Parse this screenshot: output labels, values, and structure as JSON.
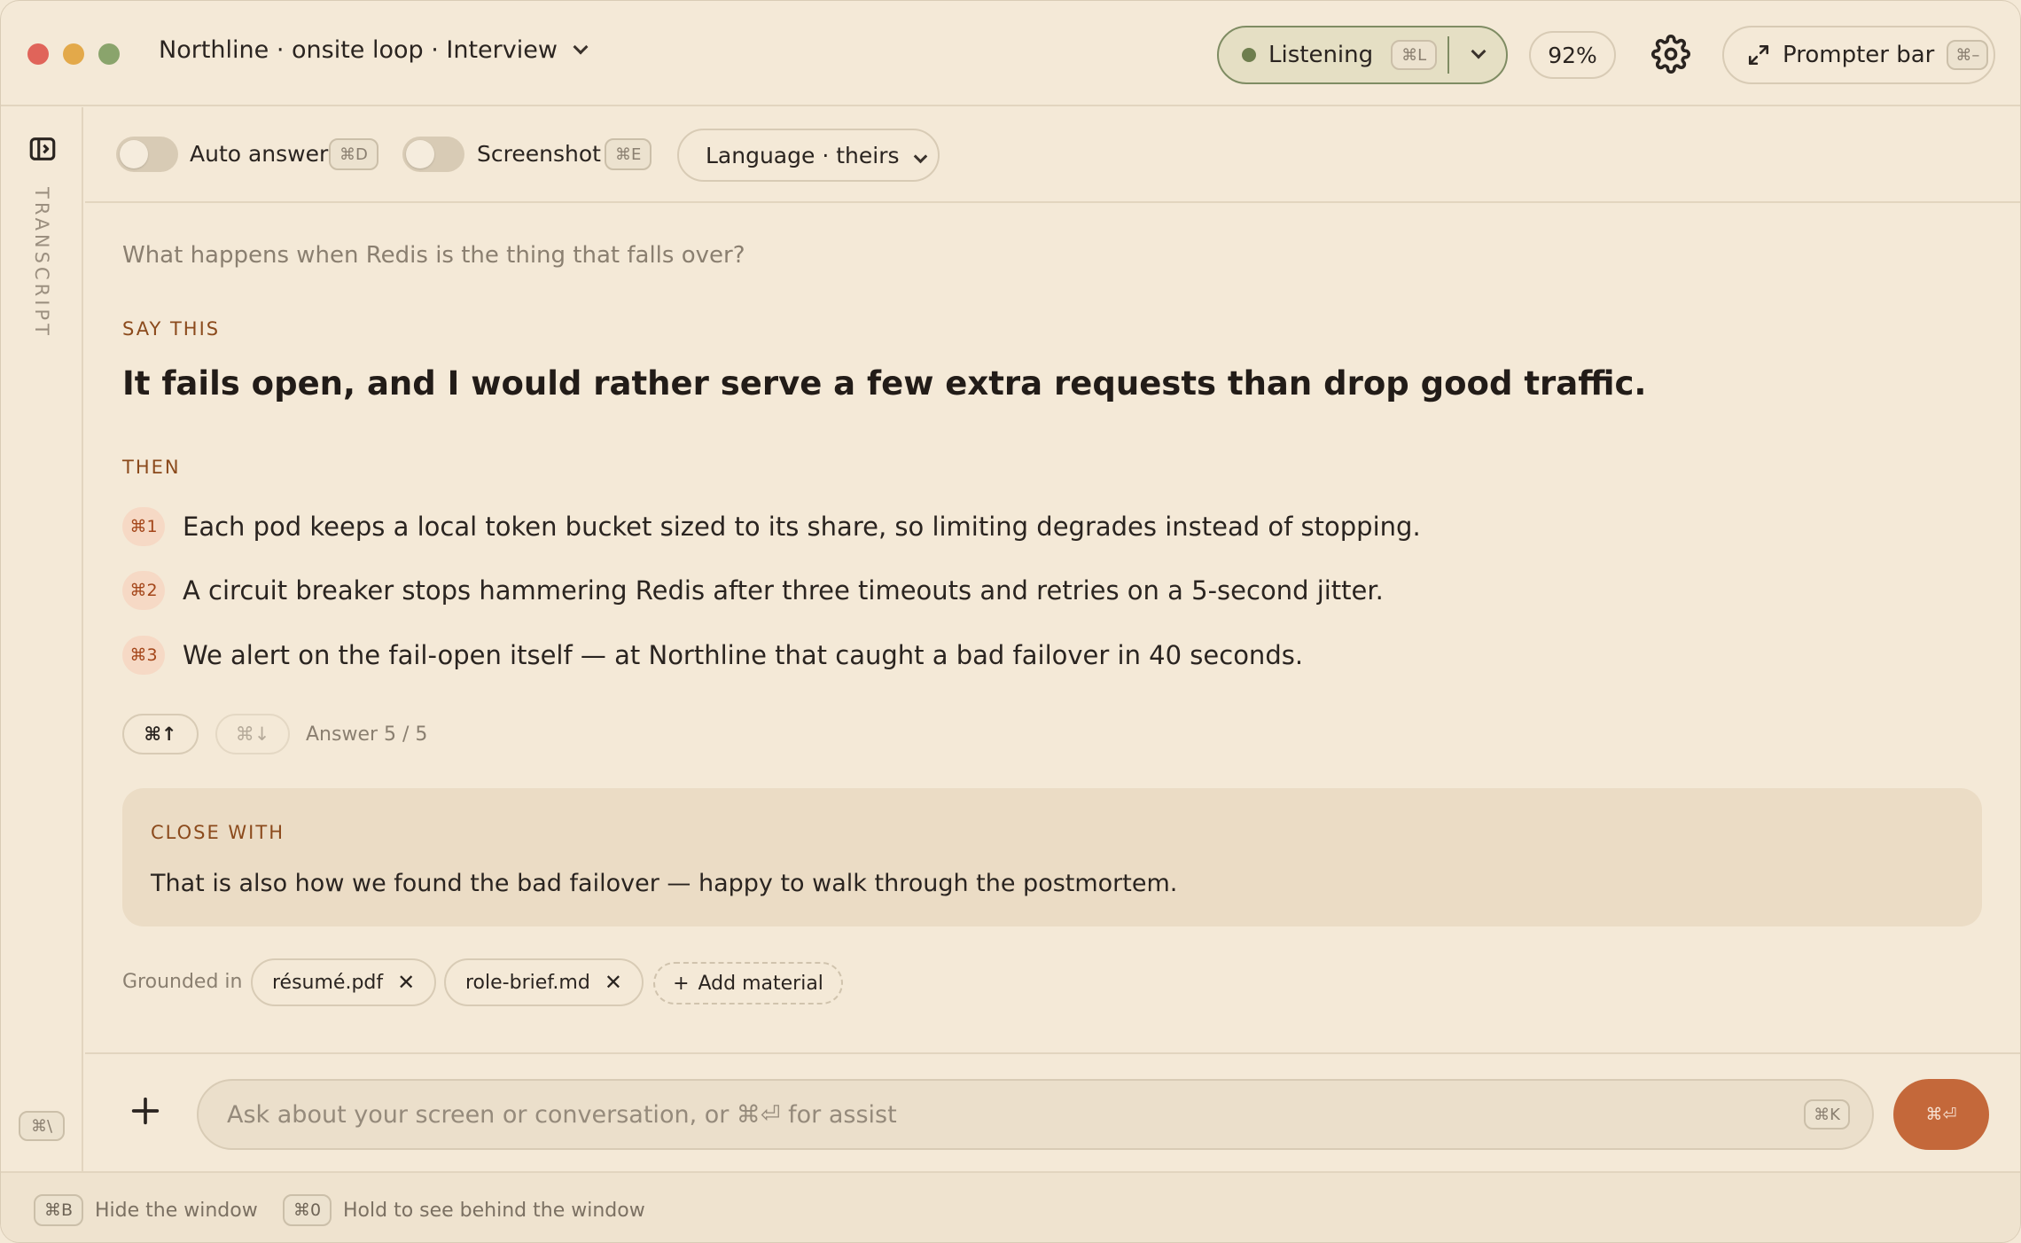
{
  "header": {
    "title": "Northline · onsite loop · Interview",
    "listening_label": "Listening",
    "listening_shortcut": "⌘L",
    "zoom": "92%",
    "prompter_label": "Prompter bar",
    "prompter_shortcut": "⌘–"
  },
  "sidebar": {
    "transcript_label": "TRANSCRIPT",
    "toggle_shortcut": "⌘\\"
  },
  "toolbar": {
    "auto_answer_label": "Auto answer",
    "auto_answer_shortcut": "⌘D",
    "auto_answer_on": false,
    "screenshot_label": "Screenshot",
    "screenshot_shortcut": "⌘E",
    "screenshot_on": false,
    "language_selected": "Language · theirs"
  },
  "main": {
    "question": "What happens when Redis is the thing that falls over?",
    "say_this_label": "SAY THIS",
    "say_this": "It fails open, and I would rather serve a few extra requests than drop good traffic.",
    "then_label": "THEN",
    "points": [
      {
        "shortcut": "⌘1",
        "text": "Each pod keeps a local token bucket sized to its share, so limiting degrades instead of stopping."
      },
      {
        "shortcut": "⌘2",
        "text": "A circuit breaker stops hammering Redis after three timeouts and retries on a 5-second jitter."
      },
      {
        "shortcut": "⌘3",
        "text": "We alert on the fail-open itself — at Northline that caught a bad failover in 40 seconds."
      }
    ],
    "nav_up_label": "⌘↑",
    "nav_down_label": "⌘↓",
    "answer_count": "Answer 5 / 5",
    "close_with_label": "CLOSE WITH",
    "close_with": "That is also how we found the bad failover — happy to walk through the postmortem.",
    "grounded_label": "Grounded in",
    "materials": [
      "résumé.pdf",
      "role-brief.md"
    ],
    "add_material_label": "Add material"
  },
  "composer": {
    "placeholder": "Ask about your screen or conversation, or ⌘⏎ for assist",
    "input_shortcut": "⌘K",
    "send_label": "⌘⏎"
  },
  "footer": {
    "hide_shortcut": "⌘B",
    "hide_label": "Hide the window",
    "peek_shortcut": "⌘0",
    "peek_label": "Hold to see behind the window"
  },
  "colors": {
    "background": "#f4e9d7",
    "accent": "#c4683a",
    "section_label": "#8b4a1c",
    "listening_dot": "#6e7e4e"
  },
  "icons": {
    "window_controls": [
      "close-dot",
      "minimize-dot",
      "zoom-dot"
    ],
    "settings": "gear-icon",
    "prompter": "expand-arrows-icon",
    "sidebar": "sidebar-panel-icon",
    "composer_add": "plus-icon"
  }
}
